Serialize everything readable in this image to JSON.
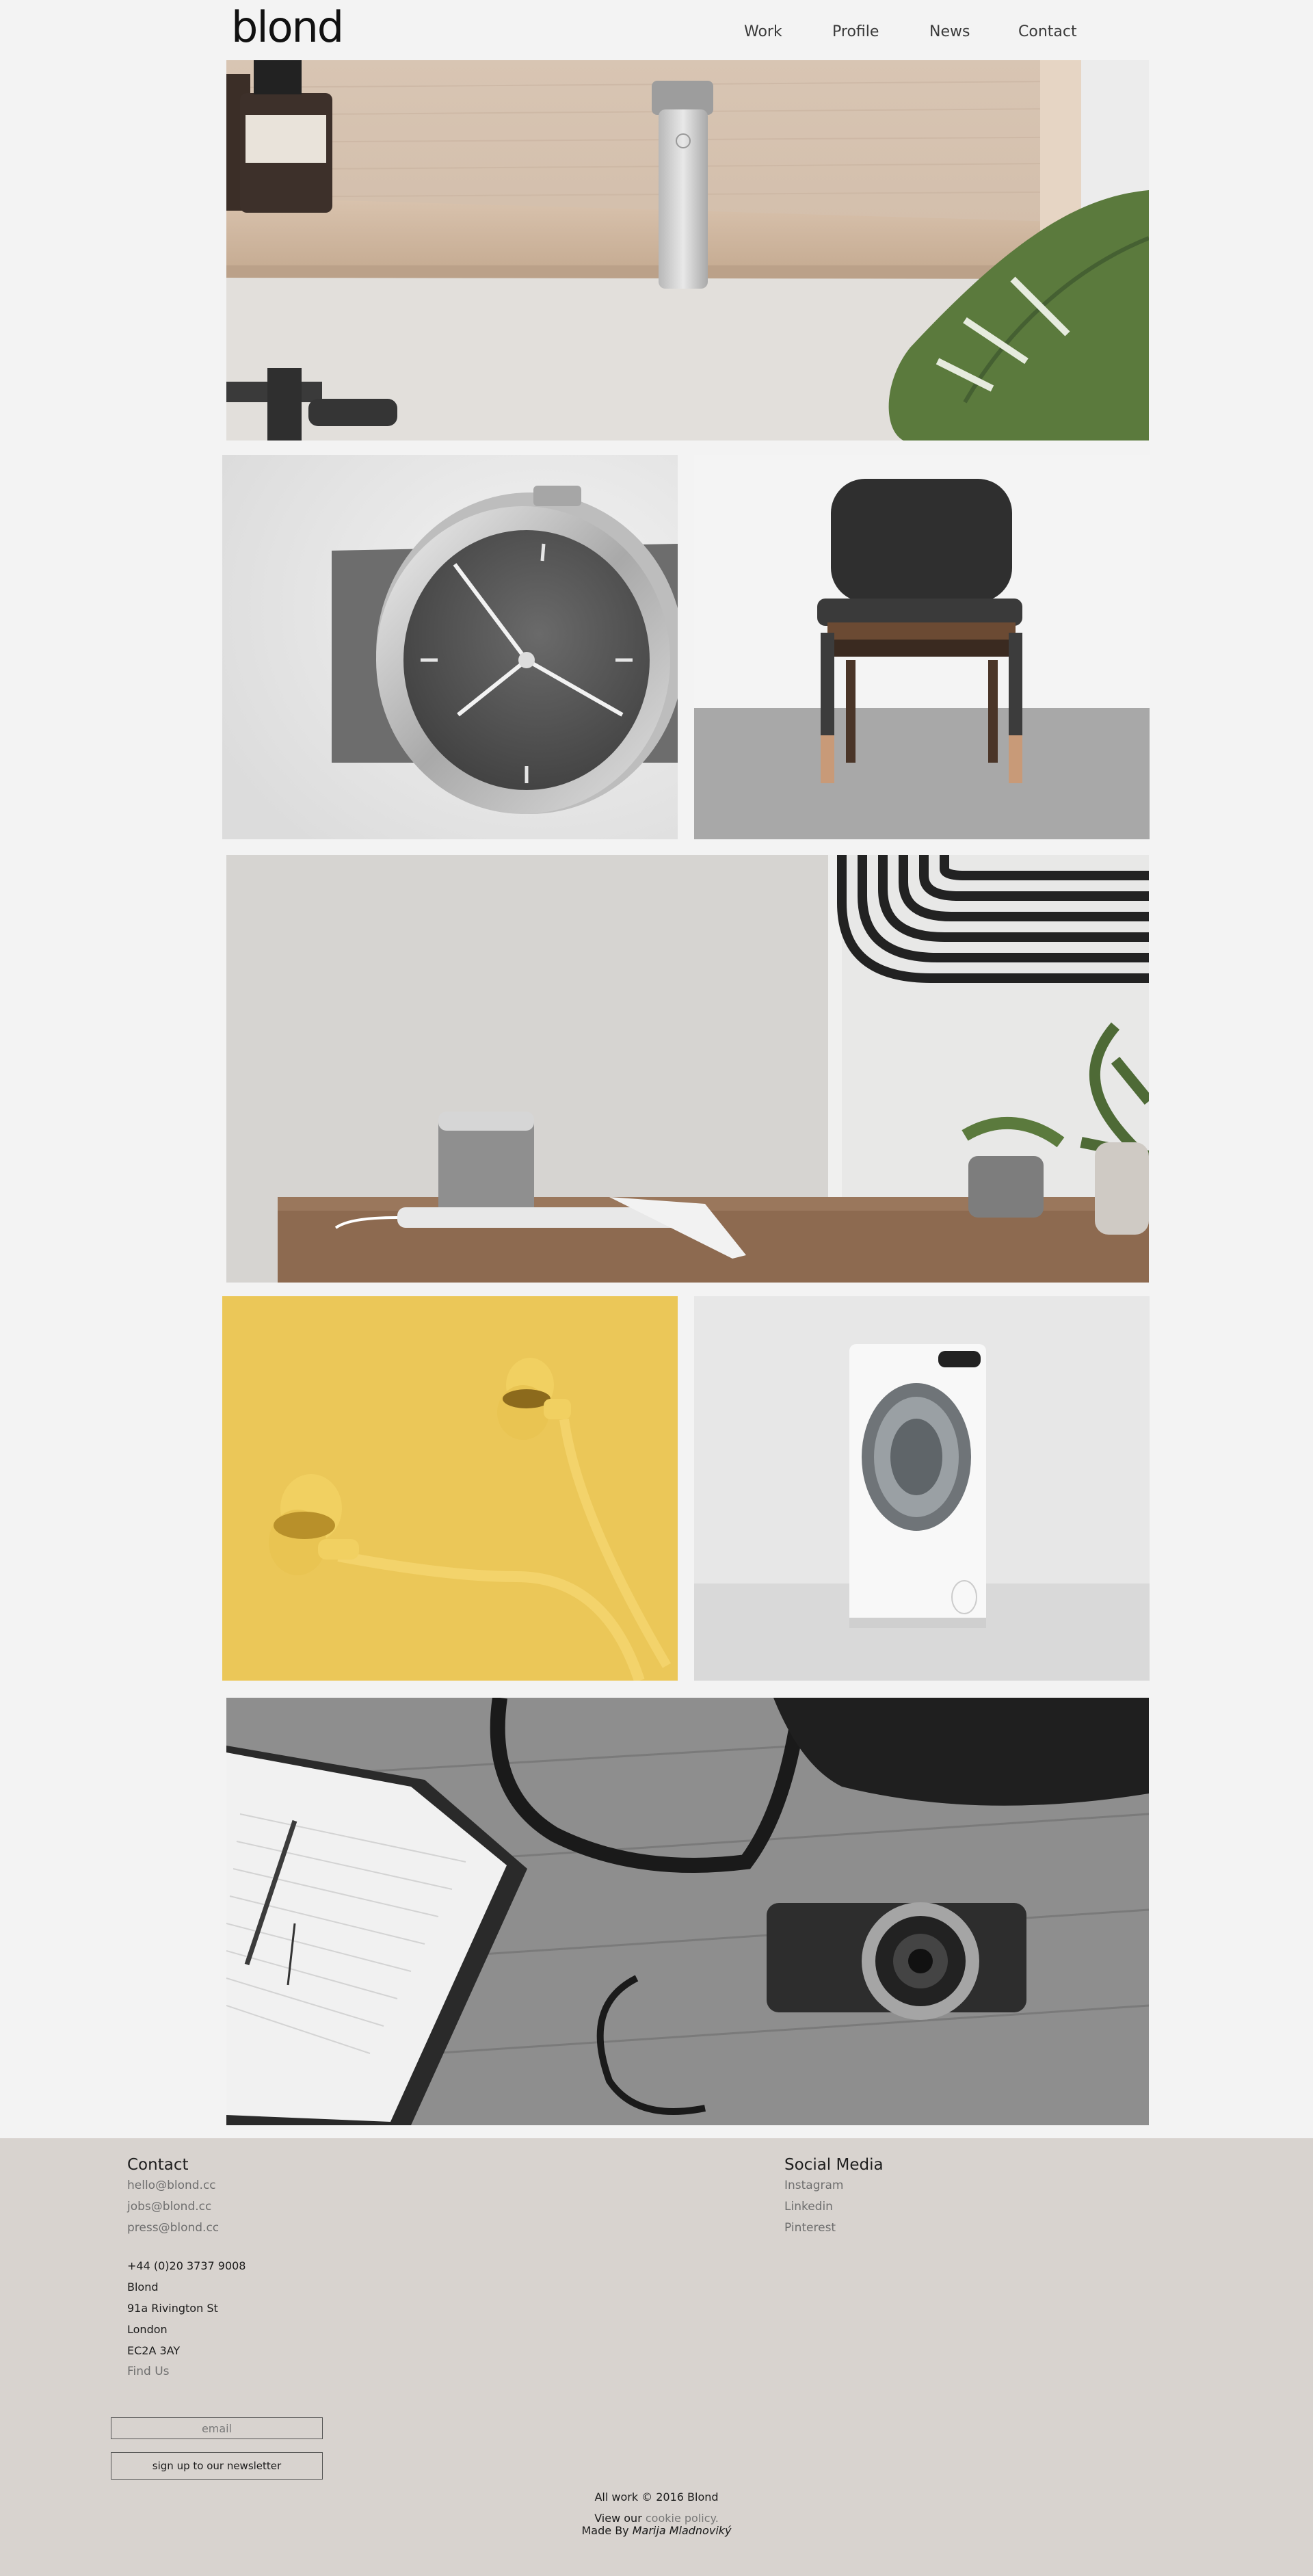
{
  "brand": {
    "logo_text": "blond"
  },
  "nav": {
    "items": [
      {
        "label": "Work"
      },
      {
        "label": "Profile"
      },
      {
        "label": "News"
      },
      {
        "label": "Contact"
      }
    ]
  },
  "gallery": {
    "tiles": [
      {
        "subject": "shaver-on-shelf"
      },
      {
        "subject": "wristwatch"
      },
      {
        "subject": "chair"
      },
      {
        "subject": "speaker-and-watch-dock"
      },
      {
        "subject": "yellow-earphones"
      },
      {
        "subject": "washing-machine"
      },
      {
        "subject": "notebook-bag-camera"
      }
    ]
  },
  "footer": {
    "contact": {
      "heading": "Contact",
      "emails": [
        "hello@blond.cc",
        "jobs@blond.cc",
        "press@blond.cc"
      ],
      "phone": "+44 (0)20 3737 9008",
      "address": [
        "Blond",
        "91a Rivington St",
        "London",
        "EC2A 3AY"
      ],
      "find_us": "Find Us"
    },
    "social": {
      "heading": "Social Media",
      "links": [
        "Instagram",
        "Linkedin",
        "Pinterest"
      ]
    },
    "newsletter": {
      "email_placeholder": "email",
      "button_label": "sign up to our newsletter"
    },
    "copyright": "All work © 2016 Blond",
    "cookie_prefix": "View our ",
    "cookie_link": "cookie policy.",
    "made_by_prefix": "Made By ",
    "made_by_name": "Marija Mladnoviký"
  },
  "colors": {
    "page_bg": "#f3f3f3",
    "footer_bg": "#d8d3cf",
    "earphones_bg": "#ebc758"
  }
}
